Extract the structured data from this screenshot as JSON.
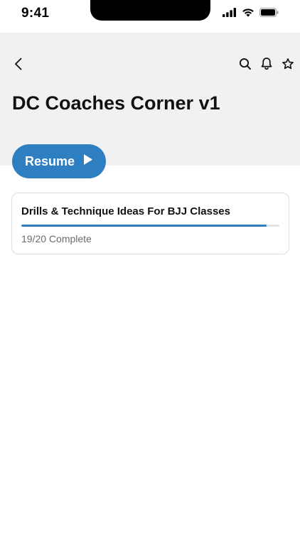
{
  "status_bar": {
    "time": "9:41",
    "icons": [
      "cellular-signal-icon",
      "wifi-icon",
      "battery-icon"
    ]
  },
  "header": {
    "back_icon": "chevron-left-icon",
    "actions": [
      "search-icon",
      "bell-icon",
      "star-icon"
    ],
    "title": "DC Coaches Corner v1"
  },
  "resume_button": {
    "label": "Resume",
    "icon": "play-icon"
  },
  "course_card": {
    "title": "Drills & Technique Ideas For BJJ Classes",
    "completed": 19,
    "total": 20,
    "progress_text": "19/20 Complete",
    "progress_fraction": 0.95
  },
  "colors": {
    "accent": "#2d7fc1",
    "header_bg": "#f1f1f1",
    "card_border": "#dcdcdc",
    "muted_text": "#6b6b6b"
  }
}
